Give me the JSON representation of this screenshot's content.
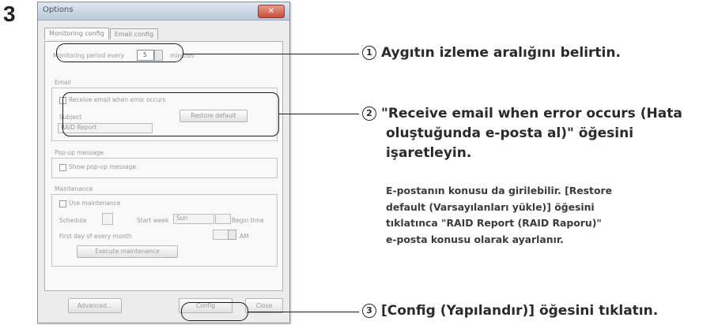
{
  "step_number": "3",
  "dialog": {
    "title": "Options",
    "close_glyph": "✕",
    "tabs": [
      "Monitoring config",
      "Email config"
    ],
    "monitoring_label": "Monitoring period every",
    "monitoring_value": "5",
    "monitoring_unit": "minutes",
    "email_group": "Email",
    "receive_email_label": "Receive email when error occurs",
    "subject_label": "Subject",
    "restore_button": "Restore default",
    "subject_value": "RAID Report",
    "popup_group": "Pop-up message",
    "show_popup_label": "Show pop-up message",
    "maintenance_group": "Maintenance",
    "use_maintenance_label": "Use maintenance",
    "schedule_label": "Schedule",
    "start_week_label": "Start week",
    "start_week_value": "Sun",
    "begin_time_label": "Begin time",
    "first_day_label": "First day of every month",
    "time_value_label": "AM",
    "exec_button": "Execute maintenance",
    "advanced_button": "Advanced...",
    "config_button": "Config",
    "close_button": "Close"
  },
  "annotations": {
    "a1": {
      "num": "1",
      "text": "Aygıtın izleme aralığını belirtin."
    },
    "a2": {
      "num": "2",
      "lines": [
        "\"Receive email when error occurs (Hata",
        "oluştuğunda e-posta al)\" öğesini",
        "işaretleyin."
      ],
      "note_lines": [
        "E-postanın konusu da girilebilir.  [Restore",
        "default (Varsayılanları yükle)] öğesini",
        "tıklatınca \"RAID Report (RAID Raporu)\"",
        "e-posta konusu olarak ayarlanır."
      ]
    },
    "a3": {
      "num": "3",
      "text": "[Config (Yapılandır)] öğesini tıklatın."
    }
  }
}
